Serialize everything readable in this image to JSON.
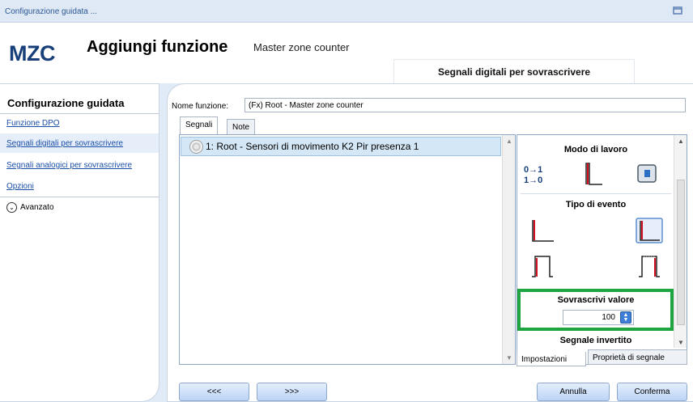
{
  "window": {
    "title": "Configurazione guidata ..."
  },
  "header": {
    "logo": "MZC",
    "title": "Aggiungi funzione",
    "subtitle": "Master zone counter",
    "step_title": "Segnali digitali per sovrascrivere"
  },
  "sidebar": {
    "title": "Configurazione guidata",
    "items": [
      {
        "label": "Funzione DPO"
      },
      {
        "label": "Segnali digitali per sovrascrivere",
        "selected": true
      },
      {
        "label": "Segnali analogici per sovrascrivere"
      },
      {
        "label": "Opzioni"
      }
    ],
    "advanced_label": "Avanzato"
  },
  "form": {
    "function_name_label": "Nome funzione:",
    "function_name_value": "(Fx) Root - Master zone counter"
  },
  "tabs": [
    {
      "label": "Segnali",
      "active": true
    },
    {
      "label": "Note",
      "active": false
    }
  ],
  "signals": [
    {
      "label": "1: Root - Sensori di movimento K2 Pir presenza 1"
    }
  ],
  "properties": {
    "work_mode_header": "Modo di lavoro",
    "work_mode_icons": [
      "toggle-01-icon",
      "rising-edge-icon",
      "device-icon"
    ],
    "event_type_header": "Tipo di evento",
    "event_type_icons": [
      "level-low-icon",
      "level-high-icon",
      "pulse-icon",
      "pulse-dotted-icon"
    ],
    "overwrite_header": "Sovrascrivi valore",
    "overwrite_value": "100",
    "inverted_header": "Segnale invertito",
    "tabs": [
      {
        "label": "Impostazioni",
        "active": true
      },
      {
        "label": "Proprietà di segnale",
        "active": false
      }
    ]
  },
  "buttons": {
    "back": "<<<",
    "next": ">>>",
    "cancel": "Annulla",
    "confirm": "Conferma"
  },
  "colors": {
    "accent": "#1fa53f",
    "brand": "#173f7a",
    "link": "#1a4ea8"
  }
}
